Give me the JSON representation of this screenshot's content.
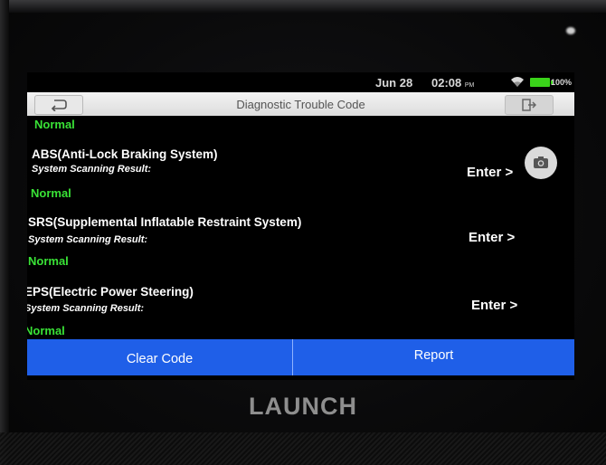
{
  "status": {
    "date": "Jun 28",
    "time": "02:08",
    "ampm": "PM",
    "battery": "100%"
  },
  "header": {
    "title": "Diagnostic Trouble Code"
  },
  "systems": [
    {
      "status": "Normal"
    },
    {
      "name": "ABS(Anti-Lock Braking System)",
      "subtitle": "System Scanning Result:",
      "status": "Normal",
      "action": "Enter >"
    },
    {
      "name": "SRS(Supplemental Inflatable Restraint System)",
      "subtitle": "System Scanning Result:",
      "status": "Normal",
      "action": "Enter >"
    },
    {
      "name": "EPS(Electric Power Steering)",
      "subtitle": "System Scanning Result:",
      "status": "Normal",
      "action": "Enter >"
    }
  ],
  "footer": {
    "clear_label": "Clear Code",
    "report_label": "Report"
  },
  "device": {
    "brand": "LAUNCH"
  },
  "icons": {
    "back": "back-arrow-icon",
    "exit": "exit-icon",
    "wifi": "wifi-icon",
    "battery": "battery-icon",
    "camera": "camera-icon"
  },
  "colors": {
    "accent": "#1f5fe8",
    "status_ok": "#39e236",
    "battery": "#3ad31a"
  }
}
